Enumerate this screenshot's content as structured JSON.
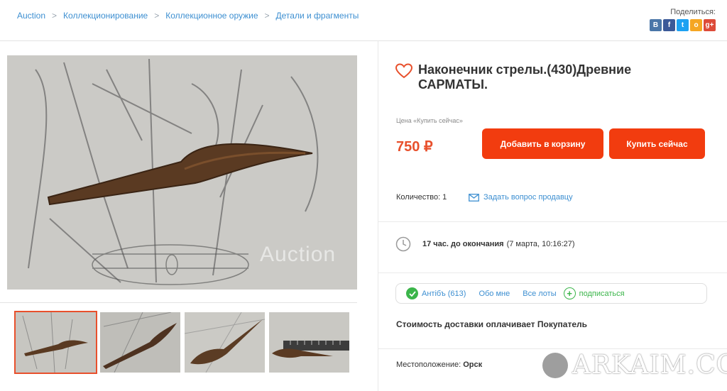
{
  "breadcrumb": {
    "items": [
      "Auction",
      "Коллекционирование",
      "Коллекционное оружие",
      "Детали и фрагменты"
    ],
    "separator": ">"
  },
  "share": {
    "label": "Поделиться:",
    "networks": [
      {
        "name": "vk",
        "glyph": "В",
        "color": "#4a76a8"
      },
      {
        "name": "facebook",
        "glyph": "f",
        "color": "#3b5998"
      },
      {
        "name": "twitter",
        "glyph": "t",
        "color": "#1da1f2"
      },
      {
        "name": "odnoklassniki",
        "glyph": "о",
        "color": "#f5a623"
      },
      {
        "name": "google-plus",
        "glyph": "g+",
        "color": "#dd4b39"
      }
    ]
  },
  "gallery": {
    "watermark": "Auction",
    "thumb_count": 4,
    "active_thumb": 0
  },
  "product": {
    "title": "Наконечник стрелы.(430)Древние САРМАТЫ.",
    "price_caption": "Цена «Купить сейчас»",
    "price": "750 ₽",
    "add_to_cart": "Добавить в корзину",
    "buy_now": "Купить сейчас",
    "quantity_label": "Количество: 1",
    "ask_seller": "Задать вопрос продавцу",
    "time_left": "17 час. до окончания",
    "end_date": "(7 марта, 10:16:27)"
  },
  "seller": {
    "rating": "Антiбъ (613)",
    "about": "Обо мне",
    "all_lots": "Все лоты",
    "subscribe": "подписаться"
  },
  "shipping": "Стоимость доставки оплачивает Покупатель",
  "location": {
    "label": "Местоположение:",
    "value": "Орск"
  },
  "brand_overlay": "ARKAIM.CO",
  "colors": {
    "accent": "#f23c0f",
    "price": "#e8502c",
    "link": "#3d8fd1",
    "success": "#3bb54a"
  }
}
